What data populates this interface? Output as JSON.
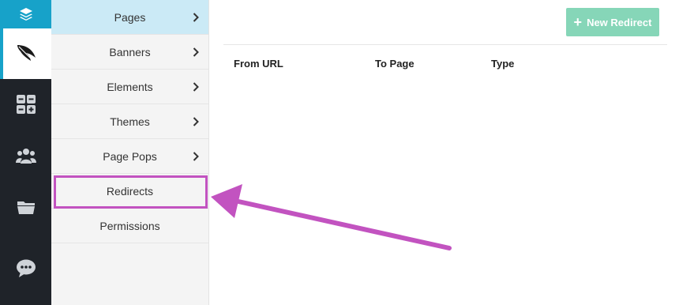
{
  "rail": {
    "icons": [
      "layers-icon",
      "feather-icon",
      "apps-grid-icon",
      "users-icon",
      "folder-icon",
      "chat-icon"
    ]
  },
  "submenu": {
    "items": [
      {
        "label": "Pages",
        "has_chevron": true,
        "active": true
      },
      {
        "label": "Banners",
        "has_chevron": true
      },
      {
        "label": "Elements",
        "has_chevron": true
      },
      {
        "label": "Themes",
        "has_chevron": true
      },
      {
        "label": "Page Pops",
        "has_chevron": true
      },
      {
        "label": "Redirects",
        "has_chevron": false,
        "highlighted": true
      },
      {
        "label": "Permissions",
        "has_chevron": false
      }
    ]
  },
  "main": {
    "new_redirect_label": "New Redirect",
    "table": {
      "headers": [
        "From URL",
        "To Page",
        "Type"
      ]
    }
  },
  "colors": {
    "rail_bg": "#1f2329",
    "accent": "#17a2c9",
    "active_item_bg": "#cbeaf6",
    "button_bg": "#86d6b8",
    "annotation": "#c253c0"
  }
}
